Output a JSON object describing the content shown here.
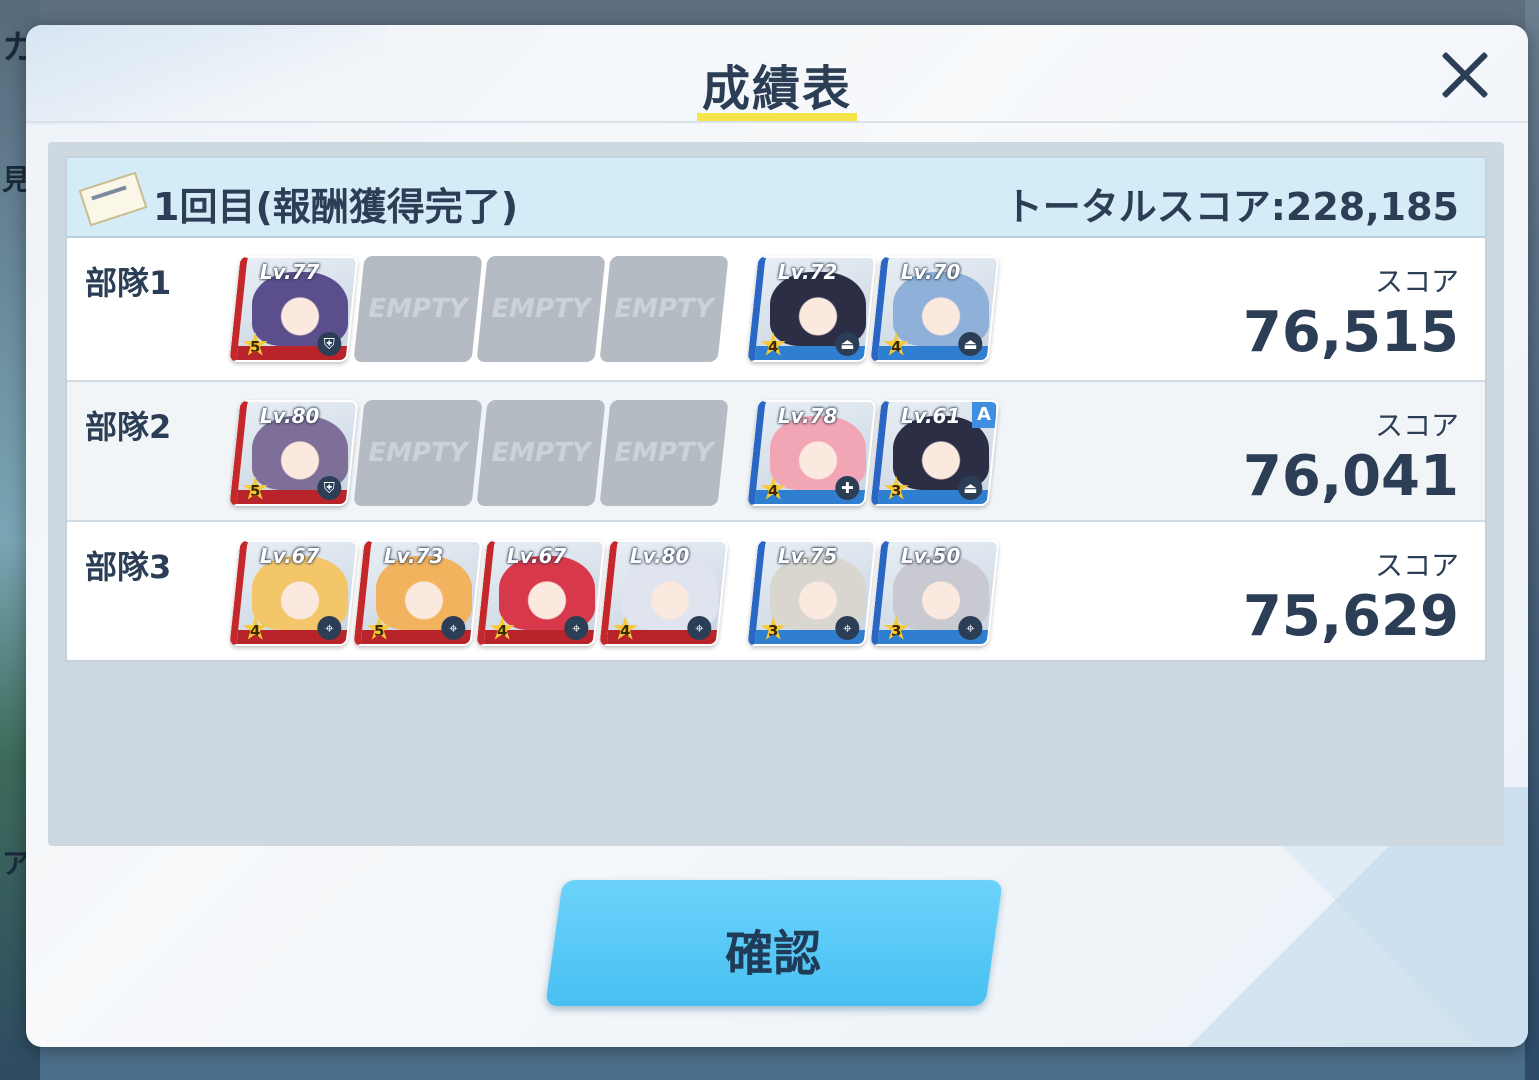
{
  "background": {
    "peek_texts": [
      "カ",
      "見る",
      "ア"
    ]
  },
  "modal": {
    "title": "成績表",
    "close_icon": "close-icon"
  },
  "round": {
    "label": "1回目(報酬獲得完了)",
    "total_score": "トータルスコア:228,185",
    "ticket_icon": "ticket-icon",
    "teams": [
      {
        "name": "部隊1",
        "score_label": "スコア",
        "score": "76,515",
        "strikers": [
          {
            "level": "Lv.77",
            "stars": "5",
            "role_icon": "shield-icon",
            "color": "#5a4e8c"
          },
          {
            "empty": "EMPTY"
          },
          {
            "empty": "EMPTY"
          },
          {
            "empty": "EMPTY"
          }
        ],
        "specials": [
          {
            "level": "Lv.72",
            "stars": "4",
            "role_icon": "support-icon",
            "color": "#2b2e45"
          },
          {
            "level": "Lv.70",
            "stars": "4",
            "role_icon": "support-icon",
            "color": "#8fb0d8"
          }
        ]
      },
      {
        "name": "部隊2",
        "score_label": "スコア",
        "score": "76,041",
        "strikers": [
          {
            "level": "Lv.80",
            "stars": "5",
            "role_icon": "shield-icon",
            "color": "#7d6f98"
          },
          {
            "empty": "EMPTY"
          },
          {
            "empty": "EMPTY"
          },
          {
            "empty": "EMPTY"
          }
        ],
        "specials": [
          {
            "level": "Lv.78",
            "stars": "4",
            "role_icon": "heal-icon",
            "color": "#f1a5b5"
          },
          {
            "level": "Lv.61",
            "stars": "3",
            "role_icon": "support-icon",
            "color": "#2b2e45",
            "assist": "A"
          }
        ]
      },
      {
        "name": "部隊3",
        "score_label": "スコア",
        "score": "75,629",
        "strikers": [
          {
            "level": "Lv.67",
            "stars": "4",
            "role_icon": "crosshair-icon",
            "color": "#f3c66a"
          },
          {
            "level": "Lv.73",
            "stars": "5",
            "role_icon": "crosshair-icon",
            "color": "#f2b25e"
          },
          {
            "level": "Lv.67",
            "stars": "4",
            "role_icon": "crosshair-icon",
            "color": "#d8394a"
          },
          {
            "level": "Lv.80",
            "stars": "4",
            "role_icon": "crosshair-icon",
            "color": "#dfe4ee"
          }
        ],
        "specials": [
          {
            "level": "Lv.75",
            "stars": "3",
            "role_icon": "crosshair-icon",
            "color": "#d9d6d0"
          },
          {
            "level": "Lv.50",
            "stars": "3",
            "role_icon": "crosshair-icon",
            "color": "#c9c9d2"
          }
        ]
      }
    ]
  },
  "confirm": {
    "label": "確認"
  }
}
